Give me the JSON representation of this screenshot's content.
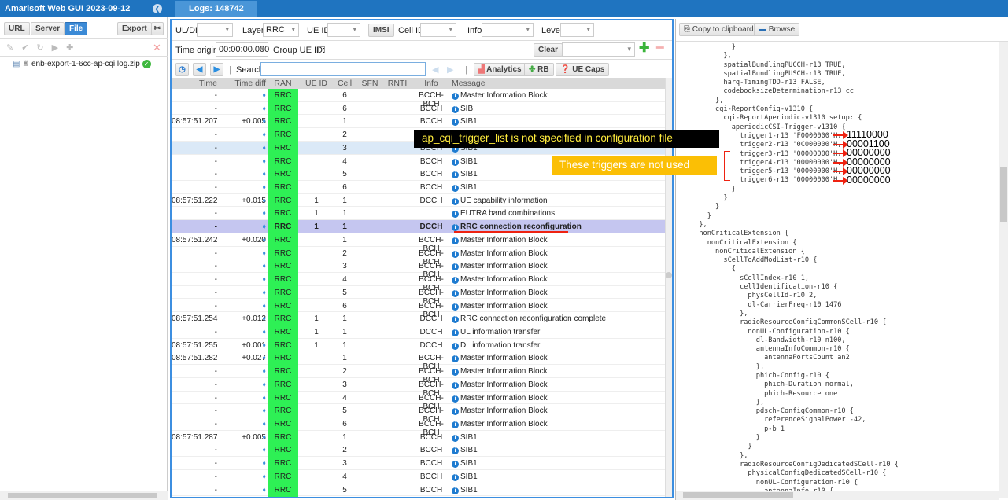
{
  "app": {
    "title": "Amarisoft Web GUI 2023-09-12",
    "tab": "Logs: 148742"
  },
  "left": {
    "buttons": [
      "URL",
      "Server",
      "File",
      "Export"
    ],
    "file": "enb-export-1-6cc-ap-cqi.log.zip"
  },
  "filters": {
    "uldl_label": "UL/DL",
    "uldl_value": "",
    "layer_label": "Layer",
    "layer_value": "RRC",
    "ueid_label": "UE ID",
    "ueid_value": "",
    "imsi": "IMSI",
    "cellid_label": "Cell ID",
    "info_label": "Info",
    "level_label": "Level",
    "time_origin_label": "Time origin:",
    "time_origin_value": "00:00:00.000",
    "group_ue_label": "Group UE ID:",
    "clear": "Clear",
    "search_label": "Search",
    "search_value": "",
    "analytics": "Analytics",
    "rb": "RB",
    "uecaps": "UE Caps"
  },
  "table": {
    "headers": [
      "Time",
      "Time diff",
      "RAN",
      "UE ID",
      "Cell",
      "SFN",
      "RNTI",
      "Info",
      "Message"
    ],
    "rows": [
      [
        "-",
        "",
        "RRC",
        "",
        "6",
        "",
        "",
        "BCCH-BCH",
        "Master Information Block"
      ],
      [
        "-",
        "",
        "RRC",
        "",
        "6",
        "",
        "",
        "BCCH",
        "SIB"
      ],
      [
        "08:57:51.207",
        "+0.005",
        "RRC",
        "",
        "1",
        "",
        "",
        "BCCH",
        "SIB1"
      ],
      [
        "-",
        "",
        "RRC",
        "",
        "2",
        "",
        "",
        "BCCH",
        "SIB1"
      ],
      [
        "-",
        "",
        "RRC",
        "",
        "3",
        "",
        "",
        "BCCH",
        "SIB1"
      ],
      [
        "-",
        "",
        "RRC",
        "",
        "4",
        "",
        "",
        "BCCH",
        "SIB1"
      ],
      [
        "-",
        "",
        "RRC",
        "",
        "5",
        "",
        "",
        "BCCH",
        "SIB1"
      ],
      [
        "-",
        "",
        "RRC",
        "",
        "6",
        "",
        "",
        "BCCH",
        "SIB1"
      ],
      [
        "08:57:51.222",
        "+0.015",
        "RRC",
        "1",
        "1",
        "",
        "",
        "DCCH",
        "UE capability information"
      ],
      [
        "-",
        "",
        "RRC",
        "1",
        "1",
        "",
        "",
        "",
        "EUTRA band combinations"
      ],
      [
        "-",
        "",
        "RRC",
        "1",
        "1",
        "",
        "",
        "DCCH",
        "RRC connection reconfiguration"
      ],
      [
        "08:57:51.242",
        "+0.020",
        "RRC",
        "",
        "1",
        "",
        "",
        "BCCH-BCH",
        "Master Information Block"
      ],
      [
        "-",
        "",
        "RRC",
        "",
        "2",
        "",
        "",
        "BCCH-BCH",
        "Master Information Block"
      ],
      [
        "-",
        "",
        "RRC",
        "",
        "3",
        "",
        "",
        "BCCH-BCH",
        "Master Information Block"
      ],
      [
        "-",
        "",
        "RRC",
        "",
        "4",
        "",
        "",
        "BCCH-BCH",
        "Master Information Block"
      ],
      [
        "-",
        "",
        "RRC",
        "",
        "5",
        "",
        "",
        "BCCH-BCH",
        "Master Information Block"
      ],
      [
        "-",
        "",
        "RRC",
        "",
        "6",
        "",
        "",
        "BCCH-BCH",
        "Master Information Block"
      ],
      [
        "08:57:51.254",
        "+0.012",
        "RRC",
        "1",
        "1",
        "",
        "",
        "DCCH",
        "RRC connection reconfiguration complete"
      ],
      [
        "-",
        "",
        "RRC",
        "1",
        "1",
        "",
        "",
        "DCCH",
        "UL information transfer"
      ],
      [
        "08:57:51.255",
        "+0.001",
        "RRC",
        "1",
        "1",
        "",
        "",
        "DCCH",
        "DL information transfer"
      ],
      [
        "08:57:51.282",
        "+0.027",
        "RRC",
        "",
        "1",
        "",
        "",
        "BCCH-BCH",
        "Master Information Block"
      ],
      [
        "-",
        "",
        "RRC",
        "",
        "2",
        "",
        "",
        "BCCH-BCH",
        "Master Information Block"
      ],
      [
        "-",
        "",
        "RRC",
        "",
        "3",
        "",
        "",
        "BCCH-BCH",
        "Master Information Block"
      ],
      [
        "-",
        "",
        "RRC",
        "",
        "4",
        "",
        "",
        "BCCH-BCH",
        "Master Information Block"
      ],
      [
        "-",
        "",
        "RRC",
        "",
        "5",
        "",
        "",
        "BCCH-BCH",
        "Master Information Block"
      ],
      [
        "-",
        "",
        "RRC",
        "",
        "6",
        "",
        "",
        "BCCH-BCH",
        "Master Information Block"
      ],
      [
        "08:57:51.287",
        "+0.005",
        "RRC",
        "",
        "1",
        "",
        "",
        "BCCH",
        "SIB1"
      ],
      [
        "-",
        "",
        "RRC",
        "",
        "2",
        "",
        "",
        "BCCH",
        "SIB1"
      ],
      [
        "-",
        "",
        "RRC",
        "",
        "3",
        "",
        "",
        "BCCH",
        "SIB1"
      ],
      [
        "-",
        "",
        "RRC",
        "",
        "4",
        "",
        "",
        "BCCH",
        "SIB1"
      ],
      [
        "-",
        "",
        "RRC",
        "",
        "5",
        "",
        "",
        "BCCH",
        "SIB1"
      ]
    ]
  },
  "right": {
    "copy": "Copy to clipboard",
    "browse": "Browse",
    "text": "          }\n        },\n        spatialBundlingPUCCH-r13 TRUE,\n        spatialBundlingPUSCH-r13 TRUE,\n        harq-TimingTDD-r13 FALSE,\n        codebooksizeDetermination-r13 cc\n      },\n      cqi-ReportConfig-v1310 {\n        cqi-ReportAperiodic-v1310 setup: {\n          aperiodicCSI-Trigger-v1310 {\n            trigger1-r13 'F0000000'H,\n            trigger2-r13 '0C000000'H,\n            trigger3-r13 '00000000'H,\n            trigger4-r13 '00000000'H,\n            trigger5-r13 '00000000'H,\n            trigger6-r13 '00000000'H\n          }\n        }\n      }\n    }\n  },\n  nonCriticalExtension {\n    nonCriticalExtension {\n      nonCriticalExtension {\n        sCellToAddModList-r10 {\n          {\n            sCellIndex-r10 1,\n            cellIdentification-r10 {\n              physCellId-r10 2,\n              dl-CarrierFreq-r10 1476\n            },\n            radioResourceConfigCommonSCell-r10 {\n              nonUL-Configuration-r10 {\n                dl-Bandwidth-r10 n100,\n                antennaInfoCommon-r10 {\n                  antennaPortsCount an2\n                },\n                phich-Config-r10 {\n                  phich-Duration normal,\n                  phich-Resource one\n                },\n                pdsch-ConfigCommon-r10 {\n                  referenceSignalPower -42,\n                  p-b 1\n                }\n              }\n            },\n            radioResourceConfigDedicatedSCell-r10 {\n              physicalConfigDedicatedSCell-r10 {\n                nonUL-Configuration-r10 {\n                  antennaInfo-r10 {"
  },
  "annotations": {
    "black": "ap_cqi_trigger_list is not specified in configuration file",
    "yellow": "These triggers are not used",
    "bits": [
      "11110000",
      "00001100",
      "00000000",
      "00000000",
      "00000000",
      "00000000"
    ]
  },
  "colors": {
    "header": "#1f74c0",
    "ran": "#2ef055",
    "highlight": "#c5c6f0"
  }
}
